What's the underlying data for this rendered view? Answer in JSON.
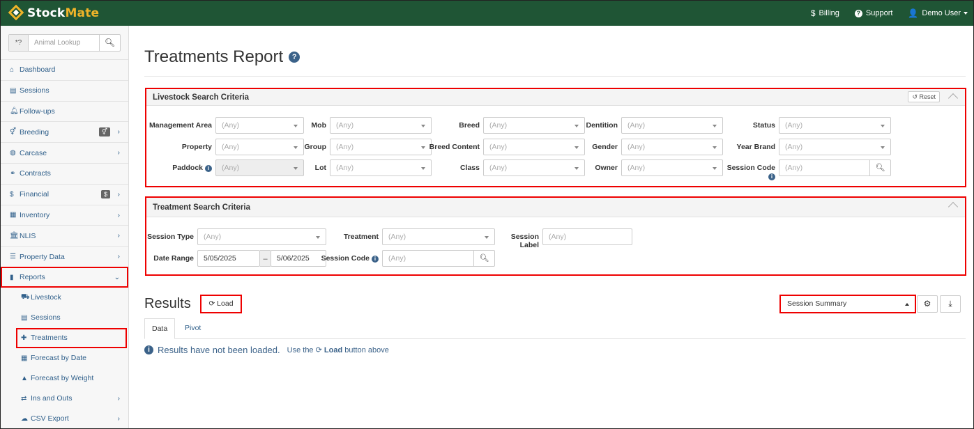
{
  "app": {
    "logo_part1": "Stock",
    "logo_part2": "Mate",
    "billing": "Billing",
    "support": "Support",
    "user": "Demo User"
  },
  "sidebar": {
    "lookup_prefix": "*?",
    "lookup_placeholder": "Animal Lookup",
    "items": [
      {
        "label": "Dashboard",
        "icon": "home-icon"
      },
      {
        "label": "Sessions",
        "icon": "table-icon"
      },
      {
        "label": "Follow-ups",
        "icon": "bell-icon"
      },
      {
        "label": "Breeding",
        "icon": "venus-mars-icon",
        "badge_icon": "venus-mars-icon"
      },
      {
        "label": "Carcase",
        "icon": "bone-icon"
      },
      {
        "label": "Contracts",
        "icon": "handshake-icon"
      },
      {
        "label": "Financial",
        "icon": "dollar-icon",
        "badge": "$"
      },
      {
        "label": "Inventory",
        "icon": "boxes-icon"
      },
      {
        "label": "NLIS",
        "icon": "bank-icon"
      },
      {
        "label": "Property Data",
        "icon": "sliders-icon"
      },
      {
        "label": "Reports",
        "icon": "chart-icon"
      }
    ],
    "sub_items": [
      {
        "label": "Livestock",
        "icon": "truck-icon"
      },
      {
        "label": "Sessions",
        "icon": "table-icon"
      },
      {
        "label": "Treatments",
        "icon": "medkit-icon"
      },
      {
        "label": "Forecast by Date",
        "icon": "calendar-icon"
      },
      {
        "label": "Forecast by Weight",
        "icon": "weight-icon"
      },
      {
        "label": "Ins and Outs",
        "icon": "exchange-icon"
      },
      {
        "label": "CSV Export",
        "icon": "cloud-download-icon"
      }
    ]
  },
  "page": {
    "title": "Treatments Report"
  },
  "livestock": {
    "title": "Livestock Search Criteria",
    "reset": "Reset",
    "any": "(Any)",
    "labels": {
      "management_area": "Management Area",
      "property": "Property",
      "paddock": "Paddock",
      "mob": "Mob",
      "group": "Group",
      "lot": "Lot",
      "breed": "Breed",
      "breed_content": "Breed Content",
      "class": "Class",
      "dentition": "Dentition",
      "gender": "Gender",
      "owner": "Owner",
      "status": "Status",
      "year_brand": "Year Brand",
      "session_code": "Session Code"
    }
  },
  "treatment": {
    "title": "Treatment Search Criteria",
    "any": "(Any)",
    "labels": {
      "session_type": "Session Type",
      "treatment": "Treatment",
      "session_label": "Session Label",
      "date_range": "Date Range",
      "session_code": "Session Code"
    },
    "date_from": "5/05/2025",
    "date_sep": "–",
    "date_to": "5/06/2025"
  },
  "results": {
    "title": "Results",
    "load": "Load",
    "view_select": "Session Summary",
    "tabs": [
      "Data",
      "Pivot"
    ],
    "message": "Results have not been loaded.",
    "hint_pre": "Use the",
    "hint_btn": "Load",
    "hint_post": "button above"
  }
}
